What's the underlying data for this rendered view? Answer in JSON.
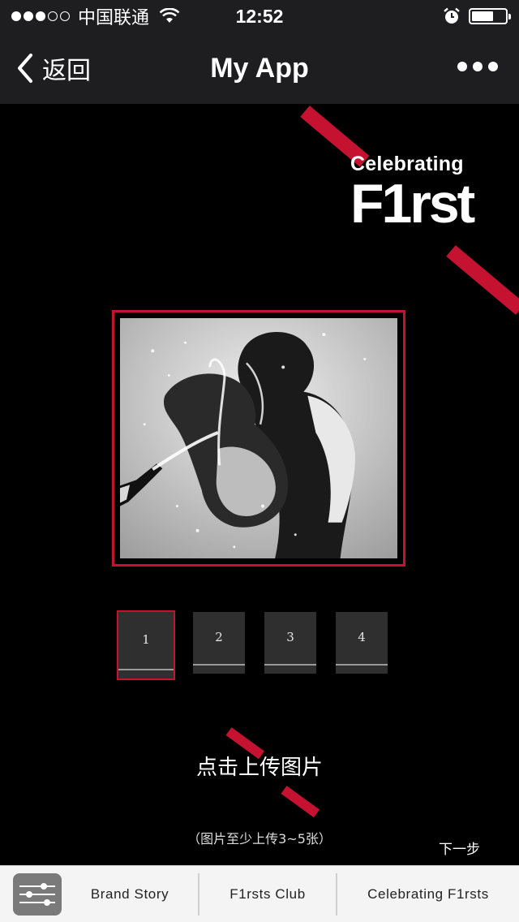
{
  "status_bar": {
    "carrier": "中国联通",
    "time": "12:52",
    "battery_level": 0.65,
    "signal_filled": 3,
    "signal_total": 5
  },
  "nav": {
    "back_label": "返回",
    "title": "My App"
  },
  "brand": {
    "line1": "Celebrating",
    "line2": "F1rst",
    "accent_color": "#c41230"
  },
  "thumbnails": [
    {
      "label": "1",
      "selected": true
    },
    {
      "label": "2",
      "selected": false
    },
    {
      "label": "3",
      "selected": false
    },
    {
      "label": "4",
      "selected": false
    }
  ],
  "upload": {
    "label": "点击上传图片",
    "hint": "（图片至少上传3~5张）"
  },
  "next_label": "下一步",
  "tab_bar": {
    "tabs": [
      {
        "label": "Brand Story"
      },
      {
        "label": "F1rsts Club"
      },
      {
        "label": "Celebrating F1rsts"
      }
    ]
  }
}
